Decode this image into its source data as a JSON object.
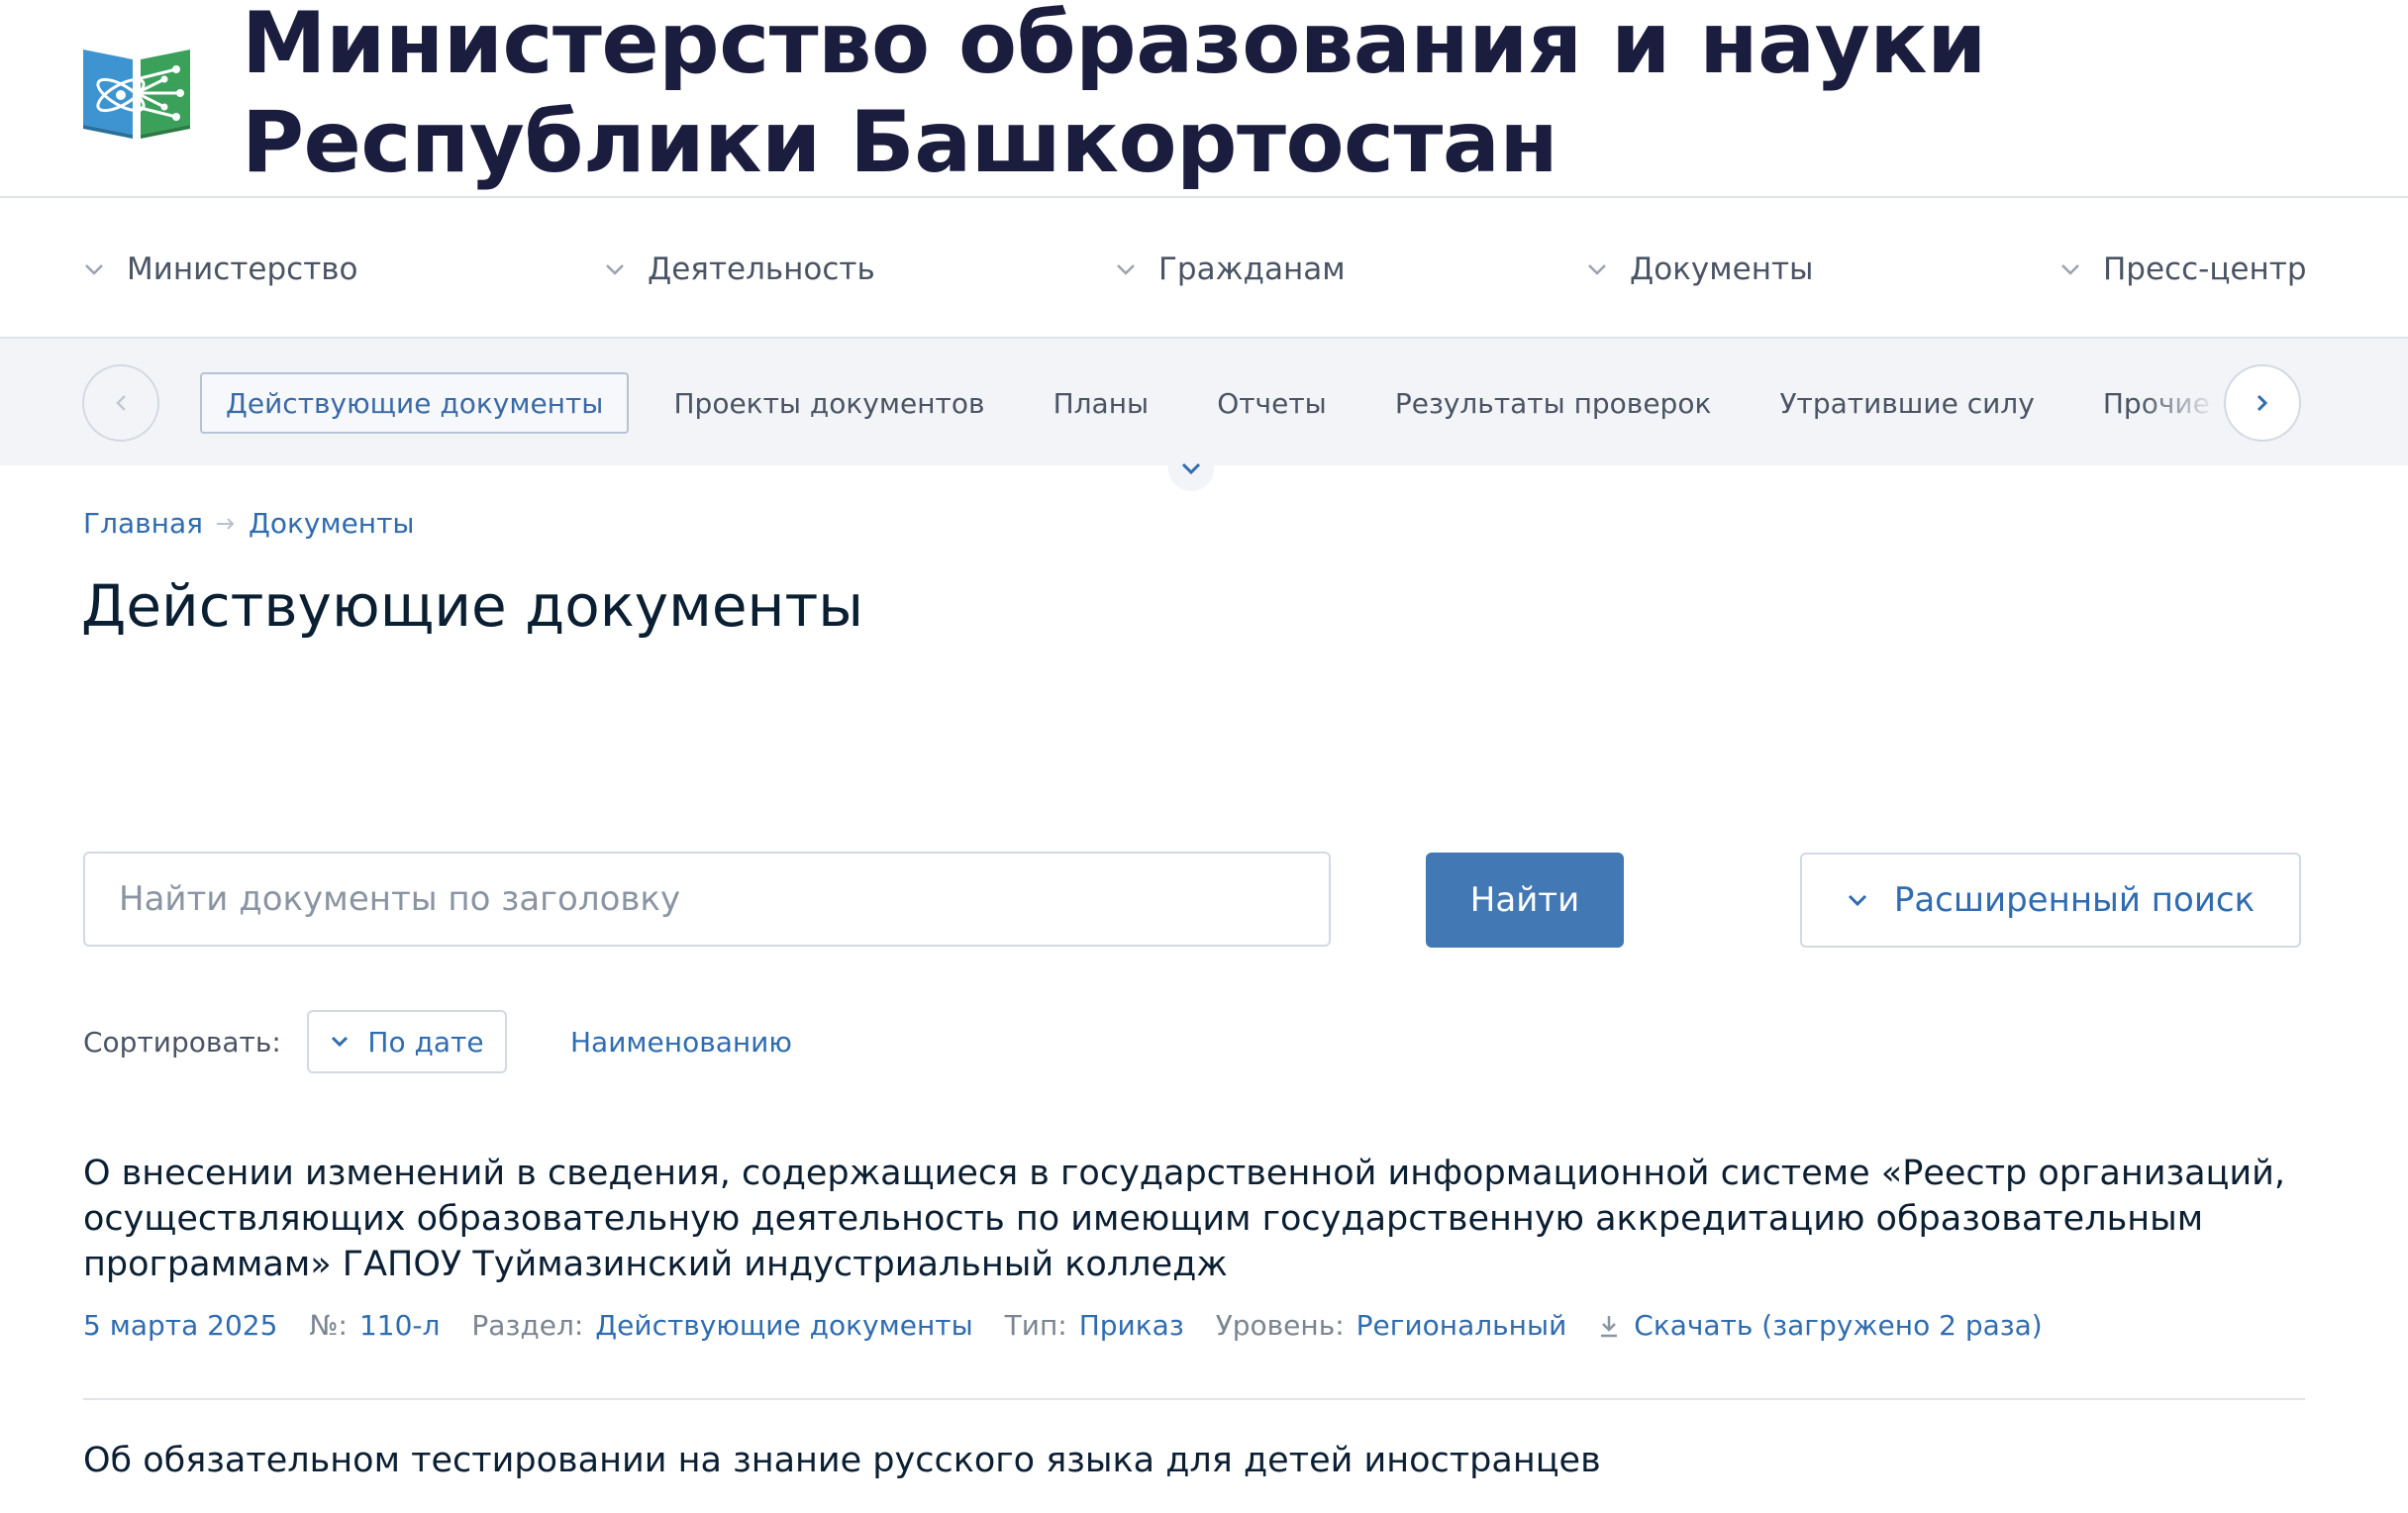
{
  "header": {
    "title_line1": "Министерство образования и науки",
    "title_line2": "Республики Башкортостан"
  },
  "main_nav": [
    {
      "label": "Министерство"
    },
    {
      "label": "Деятельность"
    },
    {
      "label": "Гражданам"
    },
    {
      "label": "Документы"
    },
    {
      "label": "Пресс-центр"
    }
  ],
  "sub_nav": [
    {
      "label": "Действующие документы",
      "active": true
    },
    {
      "label": "Проекты документов"
    },
    {
      "label": "Планы"
    },
    {
      "label": "Отчеты"
    },
    {
      "label": "Результаты проверок"
    },
    {
      "label": "Утратившие силу"
    },
    {
      "label": "Прочие документы"
    }
  ],
  "breadcrumb": {
    "home": "Главная",
    "current": "Документы"
  },
  "page_title": "Действующие документы",
  "search": {
    "placeholder": "Найти документы по заголовку",
    "button": "Найти",
    "advanced": "Расширенный поиск"
  },
  "sort": {
    "label": "Сортировать:",
    "by_date": "По дате",
    "by_name": "Наименованию"
  },
  "documents": [
    {
      "title": "О внесении изменений в сведения, содержащиеся в государственной информационной системе «Реестр организаций, осуществляющих образовательную деятельность по имеющим государственную аккредитацию образовательным программам» ГАПОУ Туймазинский индустриальный колледж",
      "date": "5 марта 2025",
      "number_label": "№:",
      "number": "110-л",
      "section_label": "Раздел:",
      "section": "Действующие документы",
      "type_label": "Тип:",
      "type": "Приказ",
      "level_label": "Уровень:",
      "level": "Региональный",
      "download": "Скачать (загружено 2 раза)"
    },
    {
      "title": "Об обязательном тестировании на знание русского языка для детей иностранцев"
    }
  ],
  "colors": {
    "accent": "#4278b4",
    "link": "#2f6cb0",
    "title": "#1b1d3f"
  }
}
